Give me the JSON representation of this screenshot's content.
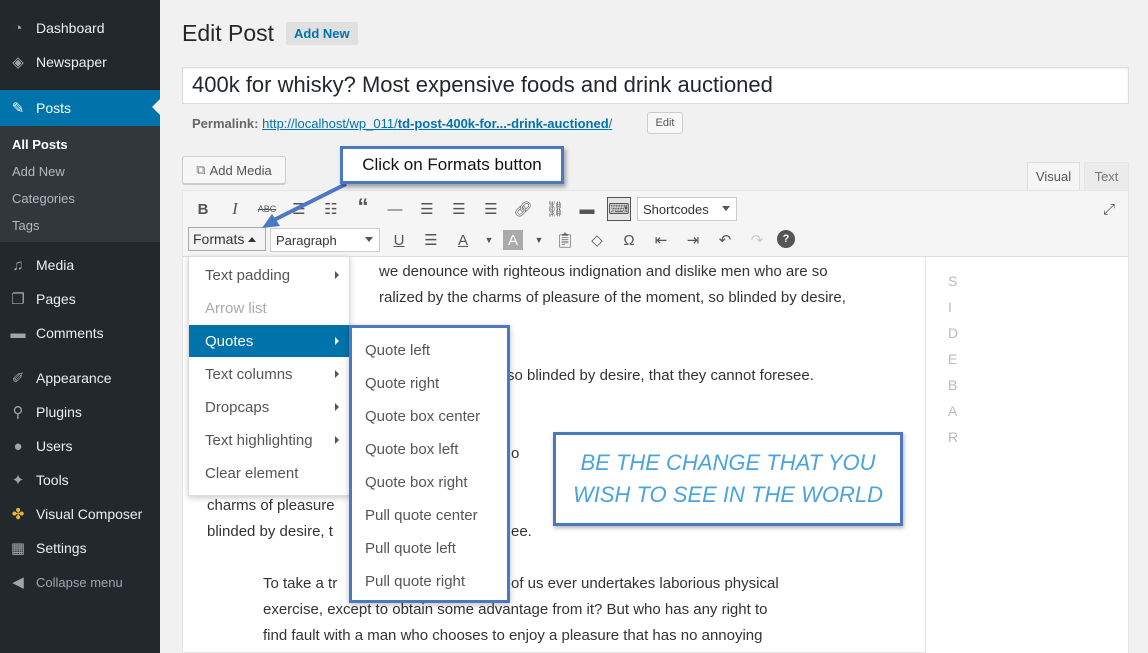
{
  "sidebar": {
    "items": [
      {
        "label": "Dashboard",
        "icon": "dashboard-icon"
      },
      {
        "label": "Newspaper",
        "icon": "newspaper-icon"
      },
      {
        "label": "Posts",
        "icon": "pin-icon"
      },
      {
        "label": "Media",
        "icon": "media-icon"
      },
      {
        "label": "Pages",
        "icon": "pages-icon"
      },
      {
        "label": "Comments",
        "icon": "comments-icon"
      },
      {
        "label": "Appearance",
        "icon": "appearance-icon"
      },
      {
        "label": "Plugins",
        "icon": "plugins-icon"
      },
      {
        "label": "Users",
        "icon": "users-icon"
      },
      {
        "label": "Tools",
        "icon": "tools-icon"
      },
      {
        "label": "Visual Composer",
        "icon": "visual-composer-icon"
      },
      {
        "label": "Settings",
        "icon": "settings-icon"
      },
      {
        "label": "Collapse menu",
        "icon": "collapse-icon"
      }
    ],
    "submenu": [
      "All Posts",
      "Add New",
      "Categories",
      "Tags"
    ]
  },
  "header": {
    "title": "Edit Post",
    "add_new": "Add New"
  },
  "post": {
    "title": "400k for whisky? Most expensive foods and drink auctioned",
    "permalink_label": "Permalink:",
    "permalink_base": "http://localhost/wp_011/",
    "permalink_slug": "td-post-400k-for...-drink-auctioned",
    "permalink_end": "/",
    "edit": "Edit"
  },
  "editor": {
    "add_media": "Add Media",
    "tab_visual": "Visual",
    "tab_text": "Text",
    "shortcodes": "Shortcodes",
    "formats": "Formats",
    "paragraph": "Paragraph",
    "content_lines": [
      "we denounce with righteous indignation and dislike men who are so",
      "ralized by the charms of pleasure of the moment, so blinded by desire,",
      "so blinded by desire, that they cannot foresee.",
      "o",
      "charms of pleasure",
      "blinded by desire, t",
      "ee.",
      "To take a tr",
      "of us ever undertakes laborious physical",
      "exercise, except to obtain some advantage from it? But who has any right to",
      "find fault with a man who chooses to enjoy a pleasure that has no annoying"
    ],
    "sidebar_letters": [
      "S",
      "I",
      "D",
      "E",
      "B",
      "A",
      "R"
    ]
  },
  "formats_menu": {
    "items": [
      "Text padding",
      "Arrow list",
      "Quotes",
      "Text columns",
      "Dropcaps",
      "Text highlighting",
      "Clear element"
    ]
  },
  "quotes_menu": {
    "items": [
      "Quote left",
      "Quote right",
      "Quote box center",
      "Quote box left",
      "Quote box right",
      "Pull quote center",
      "Pull quote left",
      "Pull quote right"
    ]
  },
  "callout": "Click on Formats button",
  "quote_box": {
    "line1": "BE THE CHANGE THAT YOU",
    "line2": "WISH TO SEE IN THE WORLD"
  },
  "colors": {
    "sidebar_bg": "#23282d",
    "active": "#0073aa",
    "annotation_border": "#4a78c2",
    "quote_text": "#4aa3df"
  }
}
